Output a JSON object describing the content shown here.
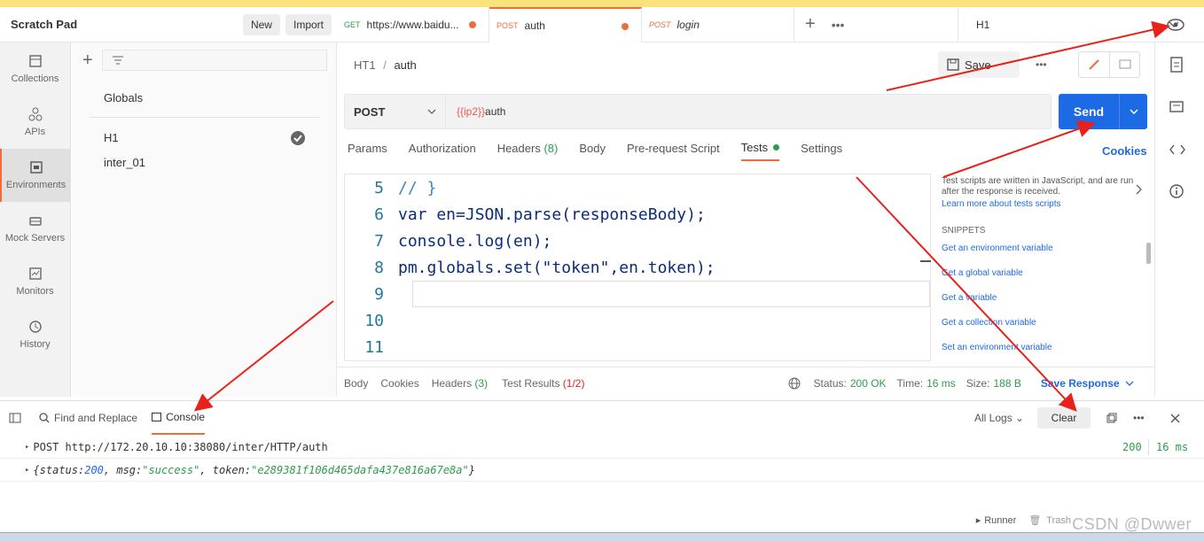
{
  "workspace": {
    "title": "Scratch Pad",
    "new_label": "New",
    "import_label": "Import"
  },
  "rail": [
    {
      "label": "Collections",
      "icon": "collections-icon"
    },
    {
      "label": "APIs",
      "icon": "apis-icon"
    },
    {
      "label": "Environments",
      "icon": "environments-icon"
    },
    {
      "label": "Mock Servers",
      "icon": "mock-servers-icon"
    },
    {
      "label": "Monitors",
      "icon": "monitors-icon"
    },
    {
      "label": "History",
      "icon": "history-icon"
    }
  ],
  "envs": {
    "globals": "Globals",
    "items": [
      "H1",
      "inter_01"
    ]
  },
  "tabs": [
    {
      "method": "GET",
      "name": "https://www.baidu..."
    },
    {
      "method": "POST",
      "name": "auth"
    },
    {
      "method": "POST",
      "name": "login"
    }
  ],
  "env_selected": "H1",
  "breadcrumb": {
    "parent": "HT1",
    "sep": "/",
    "current": "auth"
  },
  "save_label": "Save",
  "request": {
    "method": "POST",
    "url_var": "{{ip2}}",
    "url_rest": "auth",
    "send": "Send"
  },
  "req_tabs": {
    "params": "Params",
    "auth": "Authorization",
    "headers": "Headers",
    "headers_count": "(8)",
    "body": "Body",
    "pre": "Pre-request Script",
    "tests": "Tests",
    "settings": "Settings",
    "cookies": "Cookies"
  },
  "code": [
    {
      "n": "5",
      "t": "// }"
    },
    {
      "n": "6",
      "t": "var en=JSON.parse(responseBody);"
    },
    {
      "n": "7",
      "t": "console.log(en);"
    },
    {
      "n": "8",
      "t": "pm.globals.set(\"token\",en.token);"
    },
    {
      "n": "9",
      "t": ""
    },
    {
      "n": "10",
      "t": ""
    },
    {
      "n": "11",
      "t": ""
    }
  ],
  "hint": {
    "text": "Test scripts are written in JavaScript, and are run after the response is received.",
    "learn": "Learn more about tests scripts",
    "snippets": "SNIPPETS",
    "items": [
      "Get an environment variable",
      "Get a global variable",
      "Get a variable",
      "Get a collection variable",
      "Set an environment variable"
    ]
  },
  "response": {
    "body": "Body",
    "cookies": "Cookies",
    "headers": "Headers",
    "headers_count": "(3)",
    "tests": "Test Results",
    "tests_count": "(1/2)",
    "status_label": "Status:",
    "status": "200 OK",
    "time_label": "Time:",
    "time": "16 ms",
    "size_label": "Size:",
    "size": "188 B",
    "save": "Save Response"
  },
  "console": {
    "find": "Find and Replace",
    "console": "Console",
    "all_logs": "All Logs",
    "clear": "Clear",
    "request_line": "POST http://172.20.10.10:38080/inter/HTTP/auth",
    "code": "200",
    "ms": "16 ms",
    "obj_open": "{status: ",
    "obj_status": "200",
    "obj_msg_key": ", msg: ",
    "obj_msg": "\"success\"",
    "obj_token_key": ", token: ",
    "obj_token": "\"e289381f106d465dafa437e816a67e8a\"",
    "obj_close": "}"
  },
  "statusbar": {
    "runner": "Runner",
    "trash": "Trash"
  },
  "watermark": "CSDN @Dwwer",
  "colors": {
    "accent": "#f26b3a",
    "primary": "#1d6ae5",
    "arrow": "#e8221b"
  }
}
